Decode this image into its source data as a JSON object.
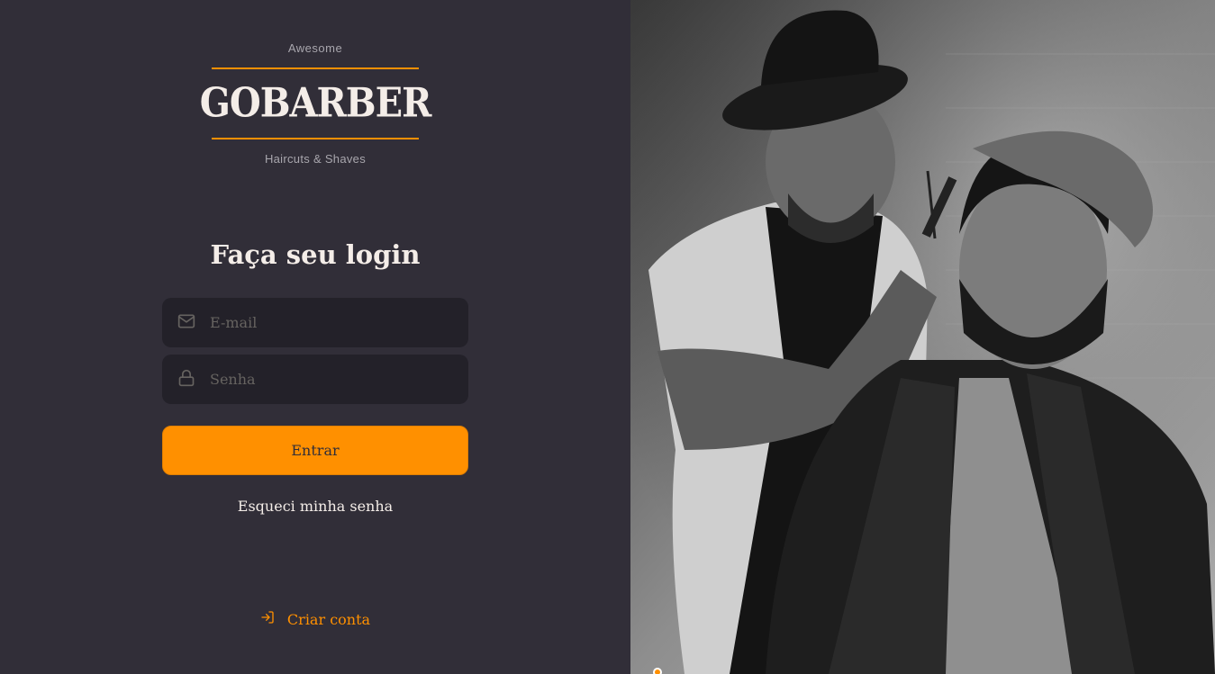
{
  "logo": {
    "top_text": "Awesome",
    "brand": "GOBARBER",
    "bottom_text": "Haircuts & Shaves"
  },
  "login": {
    "title": "Faça seu login",
    "email_placeholder": "E-mail",
    "password_placeholder": "Senha",
    "submit_label": "Entrar",
    "forgot_label": "Esqueci minha senha",
    "create_account_label": "Criar conta"
  },
  "icons": {
    "email": "mail-icon",
    "password": "lock-icon",
    "create_account": "log-in-icon"
  },
  "colors": {
    "accent": "#ff9000",
    "background": "#312e38",
    "input_background": "#232129",
    "text": "#f4ede8",
    "placeholder": "#666360"
  }
}
